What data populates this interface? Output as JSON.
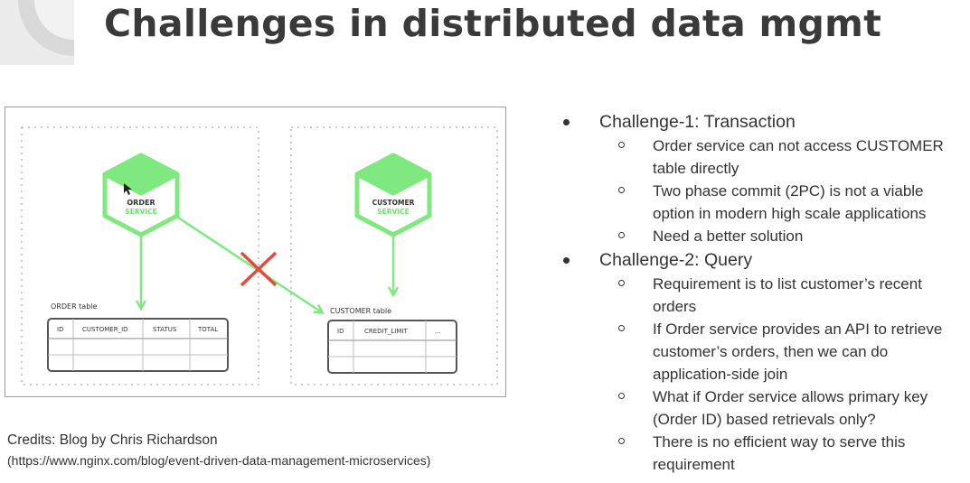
{
  "title": "Challenges in distributed data mgmt",
  "diagram": {
    "order_service": {
      "line1": "ORDER",
      "line2": "SERVICE"
    },
    "customer_service": {
      "line1": "CUSTOMER",
      "line2": "SERVICE"
    },
    "order_table": {
      "label": "ORDER table",
      "columns": [
        "ID",
        "CUSTOMER_ID",
        "STATUS",
        "TOTAL"
      ]
    },
    "customer_table": {
      "label": "CUSTOMER table",
      "columns": [
        "ID",
        "CREDIT_LIMIT",
        "..."
      ]
    },
    "colors": {
      "accent": "#7fe87f",
      "blocked": "#e24a3b"
    }
  },
  "challenges": [
    {
      "label": "Challenge-1: Transaction",
      "items": [
        [
          "Order service can not access CUSTOMER",
          "table directly"
        ],
        [
          "Two phase commit (2PC) is not a viable",
          "option in modern high scale applications"
        ],
        [
          "Need a better solution"
        ]
      ]
    },
    {
      "label": "Challenge-2: Query",
      "items": [
        [
          "Requirement is to list customer’s recent",
          "orders"
        ],
        [
          "If Order service provides an API to retrieve",
          "customer’s orders, then we can do",
          "application-side join"
        ],
        [
          "What if Order service allows primary key",
          "(Order ID) based retrievals only?"
        ],
        [
          "There is no efficient way to serve this",
          "requirement"
        ]
      ]
    }
  ],
  "credits": {
    "line1": "Credits: Blog by Chris Richardson",
    "line2": "(https://www.nginx.com/blog/event-driven-data-management-microservices)"
  }
}
